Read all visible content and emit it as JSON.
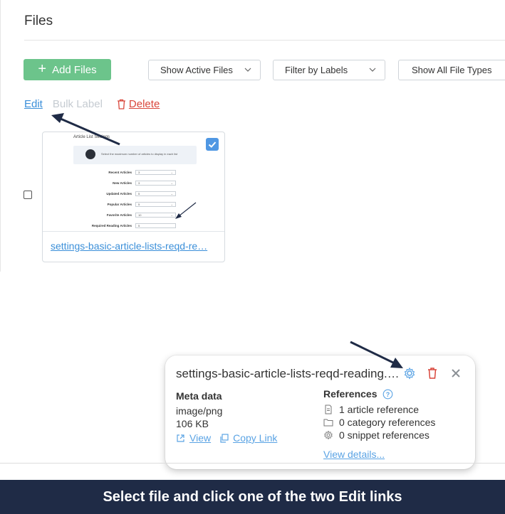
{
  "page": {
    "title": "Files"
  },
  "toolbar": {
    "add_label": "Add Files",
    "add_glyph": "+",
    "filters": [
      {
        "label": "Show Active Files"
      },
      {
        "label": "Filter by Labels"
      },
      {
        "label": "Show All File Types"
      }
    ]
  },
  "actions": {
    "edit": "Edit",
    "bulk_label": "Bulk Label",
    "delete": "Delete"
  },
  "file_card": {
    "name": "settings-basic-article-lists-reqd-re…",
    "selected": true,
    "thumbnail": {
      "title": "Article List Settings",
      "info": "Select the maximum number of articles to display in each list",
      "rows": [
        {
          "label": "Recent Articles",
          "value": "3"
        },
        {
          "label": "New Articles",
          "value": "3"
        },
        {
          "label": "Updated Articles",
          "value": "5"
        },
        {
          "label": "Popular Articles",
          "value": "5"
        },
        {
          "label": "Favorite Articles",
          "value": "10"
        },
        {
          "label": "Required Reading Articles",
          "value": "5"
        }
      ]
    }
  },
  "details": {
    "title": "settings-basic-article-lists-reqd-reading.…",
    "meta_heading": "Meta data",
    "mime": "image/png",
    "size": "106 KB",
    "view_label": "View",
    "copy_label": "Copy Link",
    "references_heading": "References",
    "refs": [
      {
        "icon": "document-icon",
        "text": "1 article reference"
      },
      {
        "icon": "folder-icon",
        "text": "0 category references"
      },
      {
        "icon": "gear-icon",
        "text": "0 snippet references"
      }
    ],
    "view_details": "View details..."
  },
  "banner": {
    "text": "Select file and click one of the two Edit links"
  },
  "colors": {
    "accent": "#3b8fd9",
    "add_button": "#6cc48b",
    "delete": "#d9463b",
    "banner": "#1f2b46",
    "arrow": "#1f2b46"
  }
}
